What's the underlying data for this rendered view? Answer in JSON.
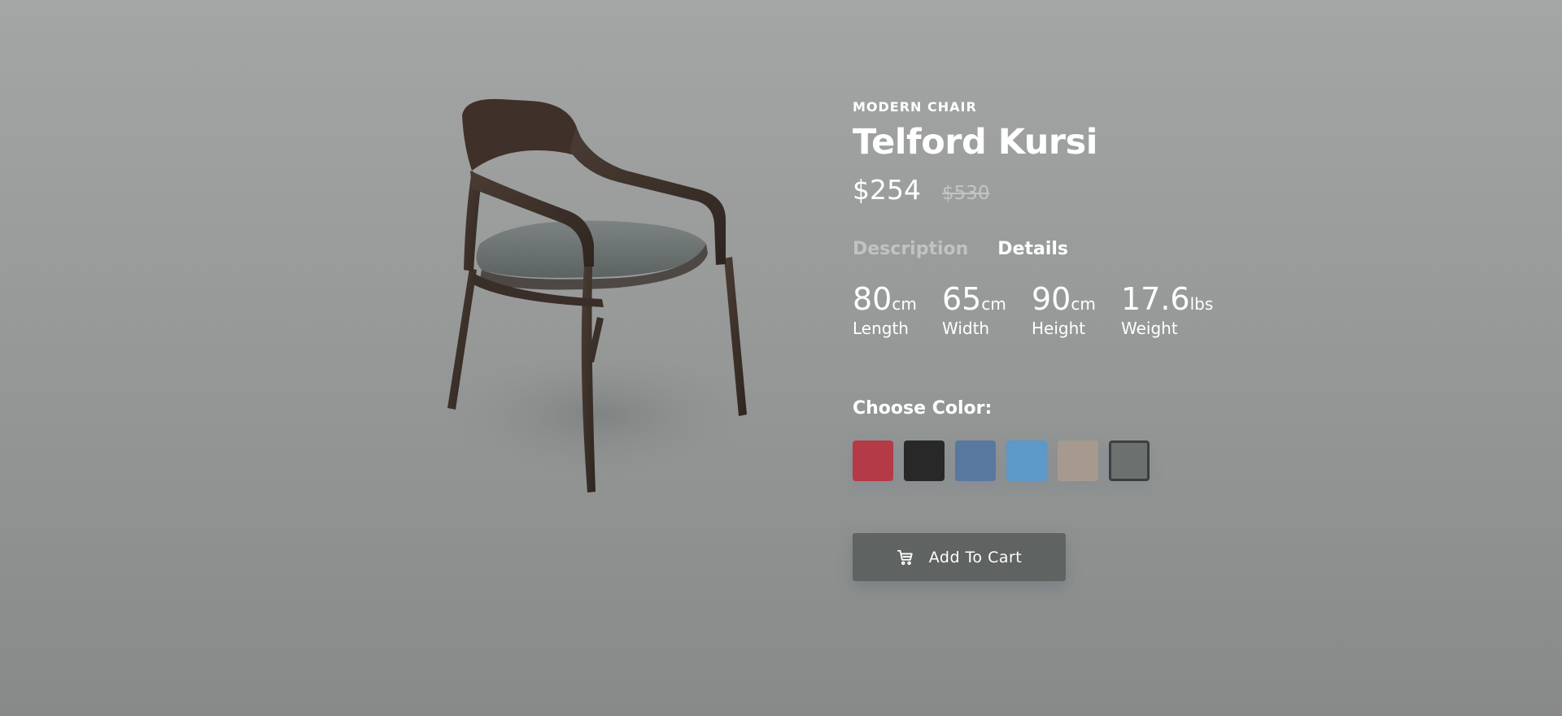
{
  "product": {
    "category": "MODERN CHAIR",
    "name": "Telford Kursi",
    "price": "$254",
    "old_price": "$530"
  },
  "tabs": [
    {
      "label": "Description",
      "active": false
    },
    {
      "label": "Details",
      "active": true
    }
  ],
  "dimensions": [
    {
      "value": "80",
      "unit": "cm",
      "label": "Length"
    },
    {
      "value": "65",
      "unit": "cm",
      "label": "Width"
    },
    {
      "value": "90",
      "unit": "cm",
      "label": "Height"
    },
    {
      "value": "17.6",
      "unit": "lbs",
      "label": "Weight"
    }
  ],
  "color_picker": {
    "label": "Choose Color:",
    "colors": [
      "#b53a47",
      "#282828",
      "#5878a0",
      "#5c98c8",
      "#a69a8f",
      "#6c706e"
    ],
    "selected_index": 5
  },
  "cart": {
    "label": "Add To Cart",
    "icon": "cart-icon"
  }
}
